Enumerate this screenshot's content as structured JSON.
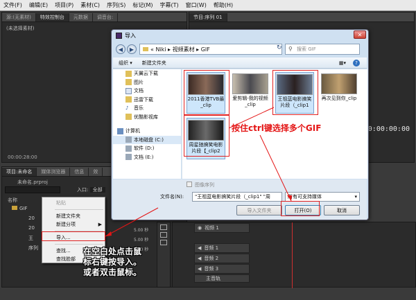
{
  "menubar": {
    "items": [
      "文件(F)",
      "编辑(E)",
      "项目(P)",
      "素材(C)",
      "序列(S)",
      "标记(M)",
      "字幕(T)",
      "窗口(W)",
      "帮助(H)"
    ]
  },
  "source_panel": {
    "tabs": [
      "源:(无素材)",
      "特效控制台",
      "元数据",
      "调音台:"
    ],
    "no_clip_text": "(未选择素材)",
    "timecode": "00:00:28:00"
  },
  "program_panel": {
    "tab": "节目:序列 01",
    "timecode": "00:00:00:00"
  },
  "project_panel": {
    "tabs": [
      "项目:未命名",
      "媒体浏览器",
      "信息",
      "效"
    ],
    "project_file": "未命名.prproj",
    "entry_label": "入口:",
    "entry_value": "全部",
    "name_header": "名称",
    "items": [
      "GIF",
      "20",
      "20",
      "王",
      "序列"
    ],
    "durations": [
      "5.00 秒",
      "5.00 秒",
      "5.00 秒"
    ]
  },
  "timeline": {
    "tracks": [
      {
        "label": "视频 1",
        "type": "video"
      },
      {
        "label": "音频 1",
        "type": "audio"
      },
      {
        "label": "音频 2",
        "type": "audio"
      },
      {
        "label": "音频 3",
        "type": "audio"
      },
      {
        "label": "主音轨",
        "type": "audio"
      }
    ]
  },
  "dialog": {
    "title": "导入",
    "address": [
      "Niki",
      "视频素材",
      "GIF"
    ],
    "search_placeholder": "搜索 GIF",
    "organize_label": "组织 ▾",
    "new_folder_label": "新建文件夹",
    "nav_items": [
      {
        "label": "天翼云下载",
        "icon": "folder-icon"
      },
      {
        "label": "图片",
        "icon": "folder-icon"
      },
      {
        "label": "文档",
        "icon": "document-icon"
      },
      {
        "label": "迅雷下载",
        "icon": "folder-icon"
      },
      {
        "label": "音乐",
        "icon": "music-icon"
      },
      {
        "label": "优酷影视库",
        "icon": "folder-icon"
      },
      {
        "label": "计算机",
        "icon": "computer-icon"
      },
      {
        "label": "本地磁盘 (C:)",
        "icon": "drive-icon"
      },
      {
        "label": "软件 (D:)",
        "icon": "drive-icon"
      },
      {
        "label": "文档 (E:)",
        "icon": "drive-icon"
      }
    ],
    "files": [
      {
        "label": "2011香港TVB最_clip",
        "selected": true
      },
      {
        "label": "爱剪辑-我的视频_clip",
        "selected": false
      },
      {
        "label": "王祖蓝电影搞笑片段（_clip1",
        "selected": true
      },
      {
        "label": "再次见到你_clip",
        "selected": false
      },
      {
        "label": "周星驰搞笑电影片段【_clip2",
        "selected": true
      }
    ],
    "image_sequence_label": "图像序列",
    "filename_label": "文件名(N):",
    "filename_value": "\"王祖蓝电影搞笑片段（_clip1\" \"周",
    "filetype_value": "所有可支持媒体",
    "import_folder_label": "导入文件夹",
    "open_label": "打开(O)",
    "cancel_label": "取消"
  },
  "context_menu": {
    "items": [
      {
        "label": "粘贴",
        "enabled": false
      },
      {
        "label": "新建文件夹",
        "enabled": true
      },
      {
        "label": "新建分项",
        "enabled": true,
        "submenu": true
      },
      {
        "label": "导入...",
        "enabled": true
      },
      {
        "label": "查找...",
        "enabled": true
      },
      {
        "label": "查找脸部",
        "enabled": true
      }
    ]
  },
  "annotations": {
    "ctrl_select": "按住ctrl键选择多个GIF",
    "right_click": [
      "在空白处点击鼠",
      "标右键按导入。",
      "或者双击鼠标。"
    ]
  },
  "colors": {
    "annotation": "#e41515",
    "dialog_bg": "#cfe0f1",
    "premiere_bg": "#2b2b2b",
    "selection": "#cde6fb"
  }
}
